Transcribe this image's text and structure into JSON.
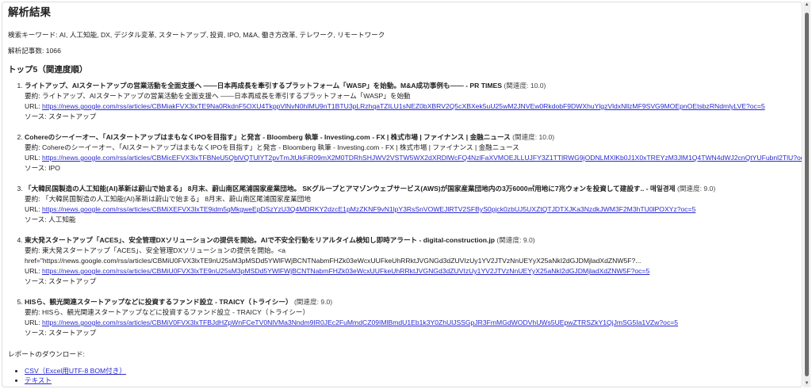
{
  "title": "解析結果",
  "keywords_line": "検索キーワード: AI, 人工知能, DX, デジタル変革, スタートアップ, 投資, IPO, M&A, 働き方改革, テレワーク, リモートワーク",
  "count_line": "解析記事数: 1066",
  "top_heading": "トップ5（関連度順）",
  "labels": {
    "summary": "要約: ",
    "url": "URL: ",
    "source": "ソース: "
  },
  "items": [
    {
      "title": "ライトアップ、AIスタートアップの営業活動を全面支援へ ――日本再成長を牽引するプラットフォーム「WASP」を始動。M&A成功事例も―― - PR TIMES",
      "score": "(関連度: 10.0)",
      "summary": "ライトアップ、AIスタートアップの営業活動を全面支援へ ――日本再成長を牽引するプラットフォーム「WASP」を始動",
      "url": "https://news.google.com/rss/articles/CBMiakFVX3lxTE9Na0RkdnF5OXU4TkppVlNvN0hIMU9nT1BTU3pLRzhqaTZILU1sNEZ0bXBRV2Q5cXBXek5uU25wM2JNVEw0RkdobF9DWXhuYlgzVldxNllzMF9SVG9MOEpnOEtsbzRNdmlyLVE?oc=5",
      "source": "スタートアップ"
    },
    {
      "title": "Cohereのシーイーオー、「AIスタートアップはまもなくIPOを目指す」と発言 - Bloomberg 執筆 - Investing.com - FX | 株式市場 | ファイナンス | 金融ニュース",
      "score": "(関連度: 10.0)",
      "summary": "Cohereのシーイーオー、「AIスタートアップはまもなくIPOを目指す」と発言 - Bloomberg 執筆 - Investing.com - FX | 株式市場 | ファイナンス | 金融ニュース",
      "url": "https://news.google.com/rss/articles/CBMicEFVX3lxTFBNeU5QblVQTUlYT2pvTmJtUkFiR09mX2M0TDRhSHJWV2VSTW5WX2dXRDlWcFQ4NzlFaXVMOEJLLUJFY3Z1TTlRWG9jODNLMXlKb0J1X0xTREYzM3JlM1Q4TWN4dWJ2cnQtYUFubnl2TlU?oc=5",
      "source": "IPO"
    },
    {
      "title": "「大韓民国製造の人工知能(AI)革新は蔚山で始まる」 8月末、蔚山南区尾浦国家産業団地。 SKグループとアマゾンウェブサービス(AWS)が国家産業団地内の3万6000㎡用地に7兆ウォンを投資して建設す.. - 매일경제",
      "score": "(関連度: 9.0)",
      "summary": "「大韓民国製造の人工知能(AI)革新は蔚山で始まる」 8月末、蔚山南区尾浦国家産業団地",
      "url": "https://news.google.com/rss/articles/CBMiXEFVX3lxTE9idm5qMkgweEpDSzYzU3Q4MDRKY2dzcE1pMzZKNF9vN1lpY3RsSnVOWEJlRTV2SFByS0pjck0zbUJ5UXZtQTJDTXJKa3NzdkJWM3F2M3hTU0lPOXYz?oc=5",
      "source": "人工知能"
    },
    {
      "title": "東大発スタートアップ「ACES」、安全管理DXソリューションの提供を開始。AIで不安全行動をリアルタイム検知し即時アラート - digital-construction.jp",
      "score": "(関連度: 9.0)",
      "summary": "東大発スタートアップ「ACES」、安全管理DXソリューションの提供を開始。<a href=\"https://news.google.com/rss/articles/CBMiU0FVX3lxTE9nU25sM3pMSDd5YWlFWjBCNTNabmFHZk03eWcxUUFkeUhRRktJVGNGd3dZUVIzUy1YV2JTVzNnUEYyX25aNkI2dGJDMjladXdZNW5F?...",
      "url": "https://news.google.com/rss/articles/CBMiU0FVX3lxTE9nU25sM3pMSDd5YWlFWjBCNTNabmFHZk03eWcxUUFkeUhRRktJVGNGd3dZUVIzUy1YV2JTVzNnUEYyX25aNkI2dGJDMjladXdZNW5F?oc=5",
      "source": "スタートアップ"
    },
    {
      "title": "HISら、観光関連スタートアップなどに投資するファンド設立 - TRAICY（トライシー）",
      "score": "(関連度: 9.0)",
      "summary": "HISら、観光関連スタートアップなどに投資するファンド設立 - TRAICY（トライシー）",
      "url": "https://news.google.com/rss/articles/CBMiV0FVX3lxTFBJdHZpWnFCeTV0NlVMa3Nndm9IR0JEc2FuMmdCZ09IMlBmdU1Eb1k3Y0ZhUlJSSGpJR3FmMGdWODVhUWs5UEpwZTRSZkY1QjJmSG5Ia1VZw?oc=5",
      "source": "スタートアップ"
    }
  ],
  "download": {
    "label": "レポートのダウンロード:",
    "links": [
      "CSV（Excel用UTF-8 BOM付き）",
      "テキスト"
    ]
  }
}
